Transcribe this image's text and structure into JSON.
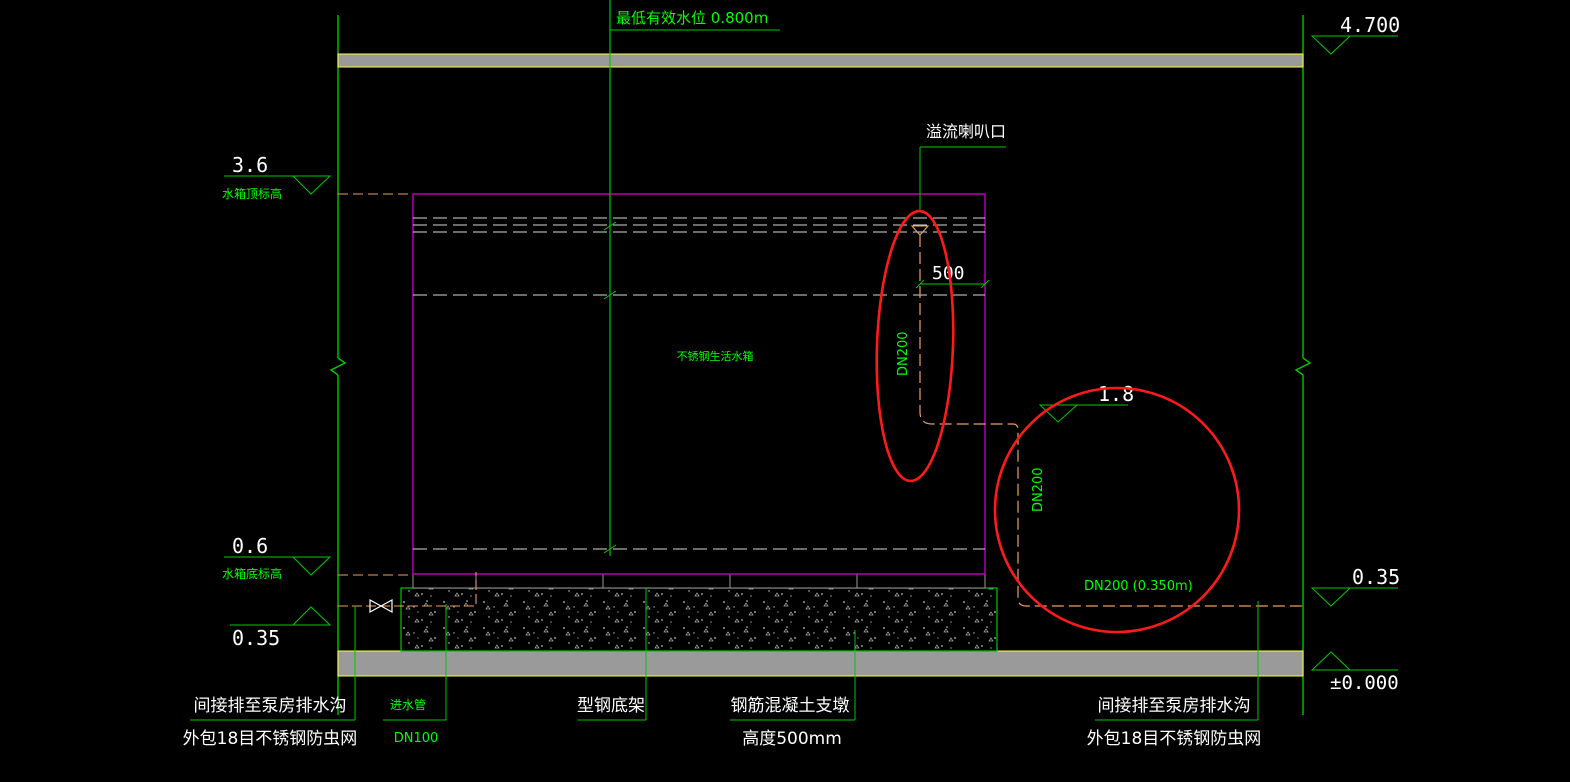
{
  "colors": {
    "background": "#000000",
    "line_green": "#00c800",
    "text_green": "#00ff00",
    "tank_magenta": "#c000c0",
    "pipe_orange": "#e8a060",
    "highlight_red": "#ff1a1a",
    "white": "#ffffff",
    "slab_gray": "#9a9a9a",
    "slab_edge_yellow": "#ffff40"
  },
  "labels": {
    "min_water_level": "最低有效水位  0.800m",
    "overflow_bellmouth": "溢流喇叭口",
    "tank_name": "不锈钢生活水箱",
    "pipe_vertical_left": "DN200",
    "pipe_vertical_right": "DN200",
    "pipe_horizontal": "DN200 (0.350m)",
    "drain_left_line1": "间接排至泵房排水沟",
    "drain_left_line2": "外包18目不锈钢防虫网",
    "inlet_pipe_name": "进水管",
    "inlet_pipe_size": "DN100",
    "steel_frame": "型钢底架",
    "concrete_pier_line1": "钢筋混凝土支墩",
    "concrete_pier_line2": "高度500mm",
    "drain_right_line1": "间接排至泵房排水沟",
    "drain_right_line2": "外包18目不锈钢防虫网"
  },
  "elevations": {
    "top_right": "4.700",
    "tank_top_value": "3.6",
    "tank_top_label": "水箱顶标高",
    "overflow_outlet": "1.8",
    "tank_bottom_value": "0.6",
    "tank_bottom_label": "水箱底标高",
    "left_drain": "0.35",
    "right_drain": "0.35",
    "floor": "±0.000"
  },
  "dimensions": {
    "overflow_offset": "500"
  }
}
